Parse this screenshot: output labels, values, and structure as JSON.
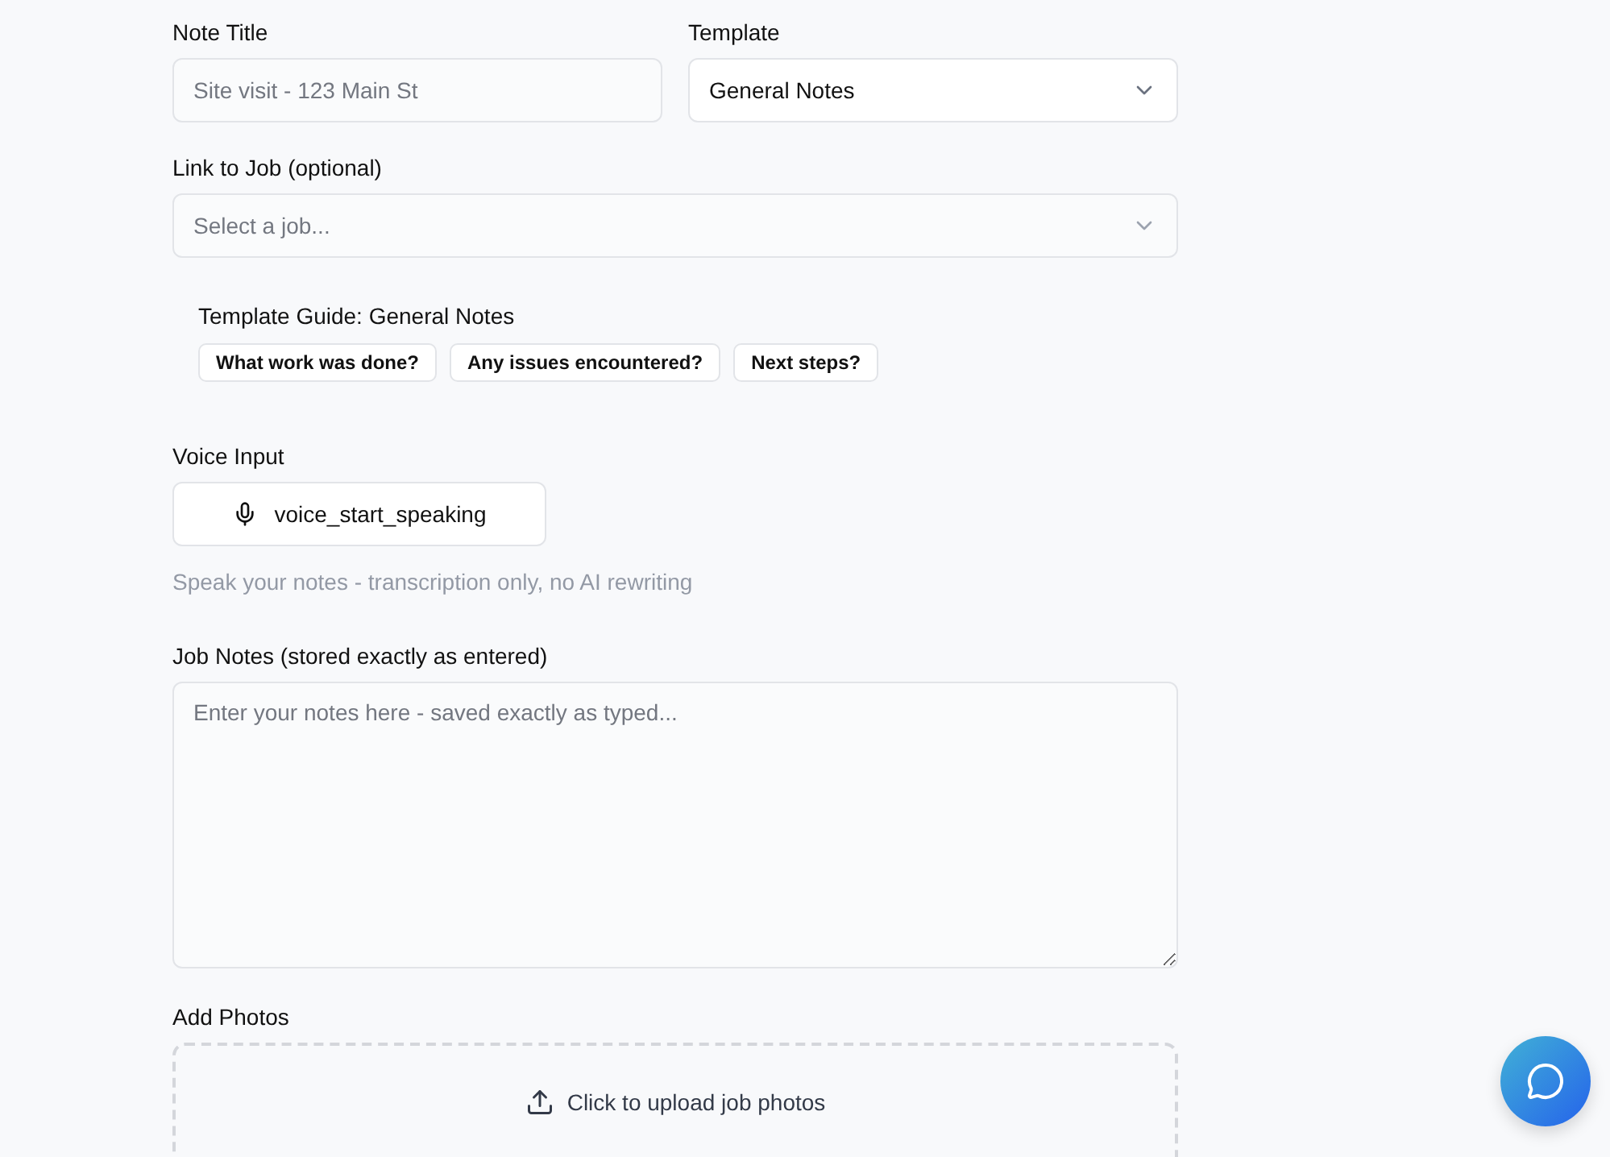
{
  "note_title": {
    "label": "Note Title",
    "placeholder": "Site visit - 123 Main St"
  },
  "template": {
    "label": "Template",
    "value": "General Notes"
  },
  "job_link": {
    "label": "Link to Job (optional)",
    "placeholder": "Select a job..."
  },
  "template_guide": {
    "title": "Template Guide: General Notes",
    "prompts": [
      "What work was done?",
      "Any issues encountered?",
      "Next steps?"
    ]
  },
  "voice_input": {
    "label": "Voice Input",
    "button": "voice_start_speaking",
    "hint": "Speak your notes - transcription only, no AI rewriting"
  },
  "job_notes": {
    "label": "Job Notes (stored exactly as entered)",
    "placeholder": "Enter your notes here - saved exactly as typed..."
  },
  "photos": {
    "label": "Add Photos",
    "upload": "Click to upload job photos"
  }
}
